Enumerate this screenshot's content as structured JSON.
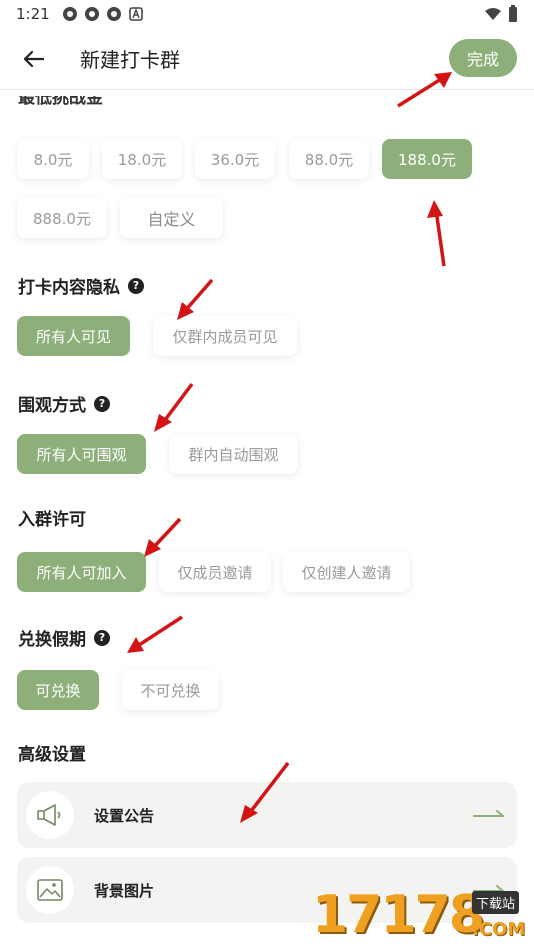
{
  "status": {
    "time": "1:21"
  },
  "appbar": {
    "title": "新建打卡群",
    "done_label": "完成"
  },
  "min_challenge": {
    "title": "最低挑战金",
    "options": [
      "8.0元",
      "18.0元",
      "36.0元",
      "88.0元",
      "188.0元",
      "888.0元",
      "自定义"
    ],
    "selected": "188.0元"
  },
  "privacy": {
    "title": "打卡内容隐私",
    "options": [
      "所有人可见",
      "仅群内成员可见"
    ],
    "selected": "所有人可见"
  },
  "watch": {
    "title": "围观方式",
    "options": [
      "所有人可围观",
      "群内自动围观"
    ],
    "selected": "所有人可围观"
  },
  "join": {
    "title": "入群许可",
    "options": [
      "所有人可加入",
      "仅成员邀请",
      "仅创建人邀请"
    ],
    "selected": "所有人可加入"
  },
  "leave": {
    "title": "兑换假期",
    "options": [
      "可兑换",
      "不可兑换"
    ],
    "selected": "可兑换"
  },
  "advanced": {
    "title": "高级设置",
    "items": [
      {
        "label": "设置公告",
        "icon": "megaphone-icon"
      },
      {
        "label": "背景图片",
        "icon": "image-icon"
      }
    ]
  },
  "watermark": {
    "digits": "17178",
    "badge": "下载站",
    "suffix": ".COM"
  },
  "colors": {
    "accent": "#8db07a",
    "annotation": "#d41414"
  }
}
